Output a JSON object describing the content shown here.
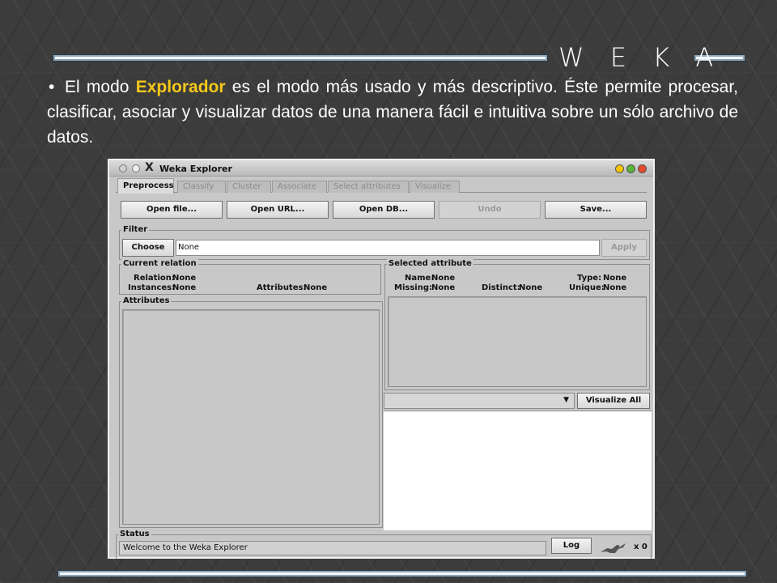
{
  "slide": {
    "title": "W E K A",
    "text_before": "El modo ",
    "text_highlight": "Explorador",
    "text_after": " es el modo más usado y más descriptivo. Éste permite procesar, clasificar, asociar y visualizar datos de una manera fácil e intuitiva sobre un sólo archivo de datos.",
    "bullet": "•",
    "highlight_color": "#f5c81a"
  },
  "window": {
    "title": "Weka Explorer",
    "logo_glyph": "X",
    "controls": [
      "minimize-icon",
      "maximize-icon",
      "close-icon"
    ]
  },
  "tabs": [
    "Preprocess",
    "Classify",
    "Cluster",
    "Associate",
    "Select attributes",
    "Visualize"
  ],
  "toolbar": {
    "open_file": "Open file...",
    "open_url": "Open URL...",
    "open_db": "Open DB...",
    "undo": "Undo",
    "save": "Save..."
  },
  "filter": {
    "title": "Filter",
    "choose": "Choose",
    "value": "None",
    "apply": "Apply"
  },
  "current_relation": {
    "title": "Current relation",
    "relation_label": "Relation:",
    "relation_value": "None",
    "instances_label": "Instances:",
    "instances_value": "None",
    "attributes_label": "Attributes:",
    "attributes_value": "None"
  },
  "attributes_panel": {
    "title": "Attributes"
  },
  "selected_attribute": {
    "title": "Selected attribute",
    "name_label": "Name:",
    "name_value": "None",
    "type_label": "Type:",
    "type_value": "None",
    "missing_label": "Missing:",
    "missing_value": "None",
    "distinct_label": "Distinct:",
    "distinct_value": "None",
    "unique_label": "Unique:",
    "unique_value": "None"
  },
  "visualize_all": "Visualize All",
  "status": {
    "title": "Status",
    "text": "Welcome to the Weka Explorer",
    "log": "Log",
    "count": "x 0"
  }
}
